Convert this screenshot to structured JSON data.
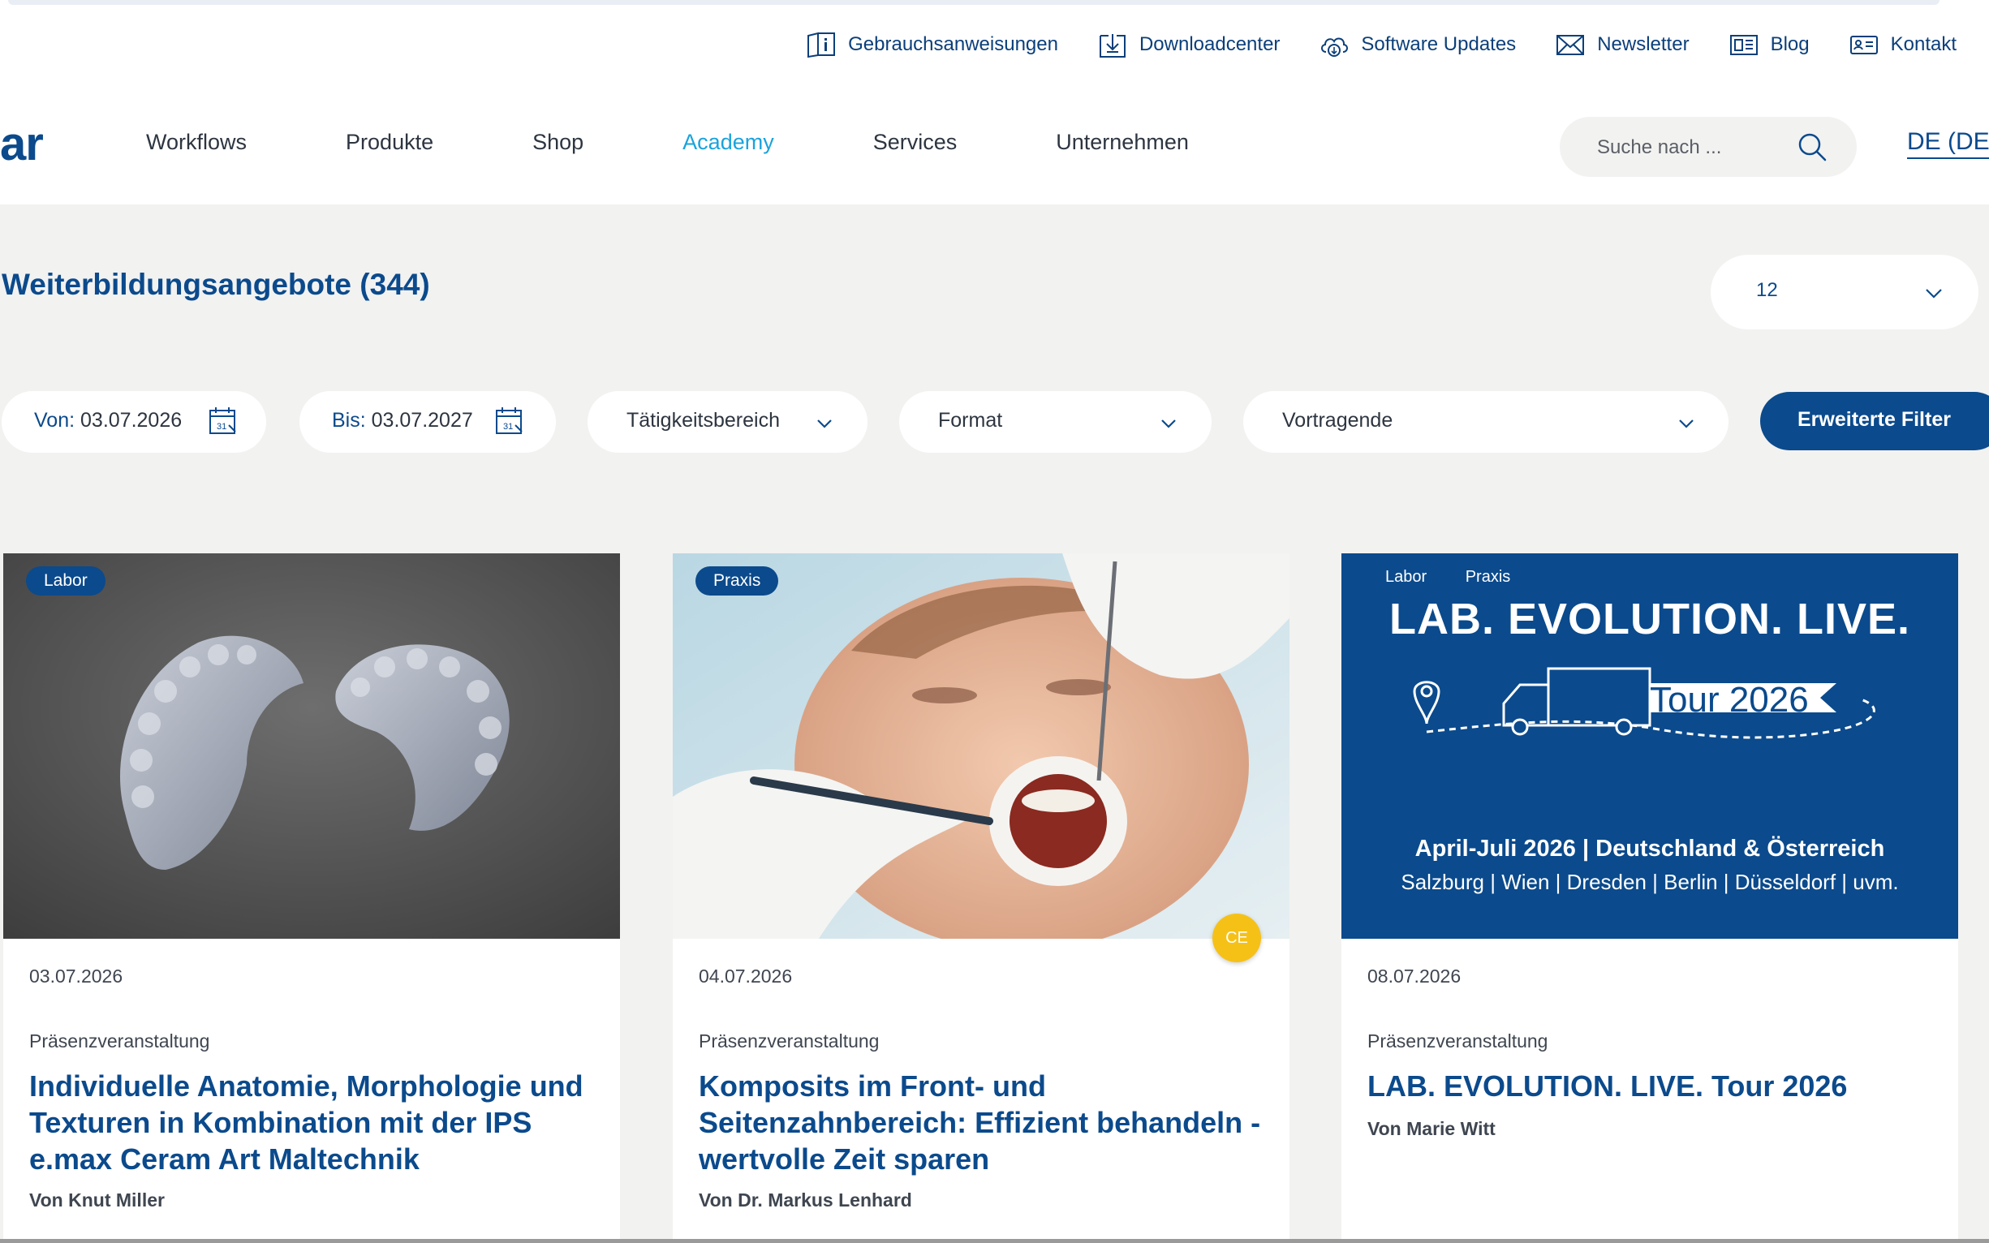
{
  "utility": {
    "links": [
      {
        "label": "Gebrauchsanweisungen",
        "icon": "manual-icon"
      },
      {
        "label": "Downloadcenter",
        "icon": "download-icon"
      },
      {
        "label": "Software Updates",
        "icon": "cloud-download-icon"
      },
      {
        "label": "Newsletter",
        "icon": "envelope-icon"
      },
      {
        "label": "Blog",
        "icon": "blog-icon"
      },
      {
        "label": "Kontakt",
        "icon": "contact-card-icon"
      }
    ]
  },
  "nav": {
    "logo": "ar",
    "items": [
      "Workflows",
      "Produkte",
      "Shop",
      "Academy",
      "Services",
      "Unternehmen"
    ],
    "active": "Academy",
    "search_placeholder": "Suche nach ...",
    "language": "DE (DE"
  },
  "listing": {
    "title": "Weiterbildungsangebote",
    "count": "(344)",
    "per_page": "12"
  },
  "filters": {
    "from_label": "Von:",
    "from_value": "03.07.2026",
    "to_label": "Bis:",
    "to_value": "03.07.2027",
    "activity": "Tätigkeitsbereich",
    "format": "Format",
    "speakers": "Vortragende",
    "advanced": "Erweiterte Filter"
  },
  "cards": [
    {
      "tags": [
        "Labor"
      ],
      "date": "03.07.2026",
      "format": "Präsenzveranstaltung",
      "title": "Individuelle Anatomie, Morphologie und Texturen in Kombination mit der IPS e.max Ceram Art Maltechnik",
      "author": "Von Knut Miller"
    },
    {
      "tags": [
        "Praxis"
      ],
      "date": "04.07.2026",
      "format": "Präsenzveranstaltung",
      "title": "Komposits im Front- und Seitenzahnbereich: Effizient behandeln - wertvolle Zeit sparen",
      "author": "Von Dr. Markus Lenhard",
      "badge": "CE"
    },
    {
      "tags": [
        "Labor",
        "Praxis"
      ],
      "date": "08.07.2026",
      "format": "Präsenzveranstaltung",
      "title": "LAB. EVOLUTION. LIVE. Tour 2026",
      "author": "Von Marie Witt",
      "banner": {
        "headline": "LAB. EVOLUTION. LIVE.",
        "tour": "Tour 2026",
        "line1": "April-Juli 2026 | Deutschland & Österreich",
        "line2": "Salzburg | Wien | Dresden | Berlin | Düsseldorf | uvm."
      }
    }
  ],
  "colors": {
    "brand_blue": "#0b4a8c",
    "active_nav": "#1aa3dc",
    "background": "#f2f2f1",
    "ce_badge": "#f6c117"
  }
}
